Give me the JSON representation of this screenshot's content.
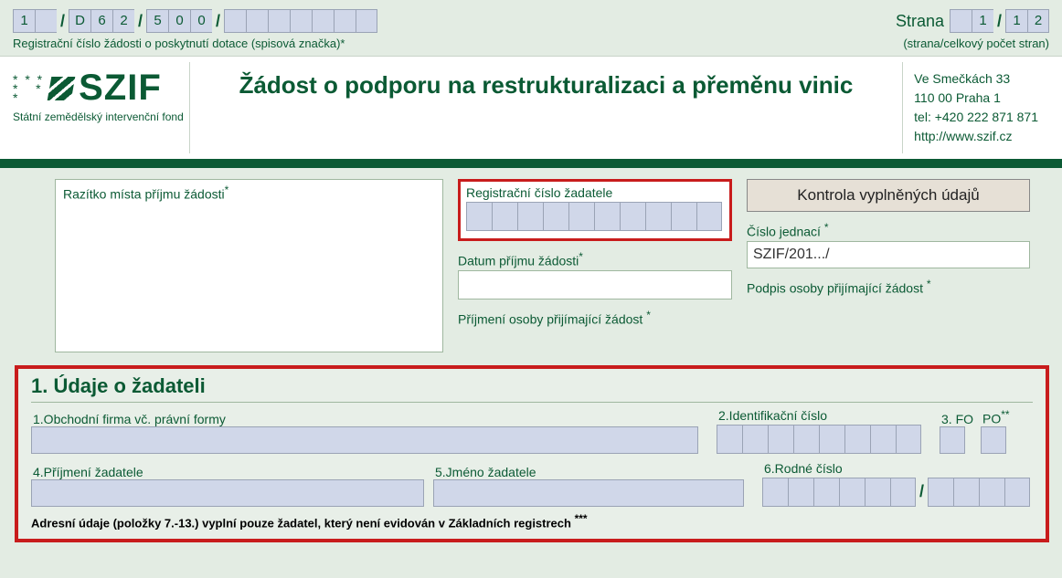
{
  "top": {
    "reg_cells1": [
      "1",
      ""
    ],
    "sep1": "/",
    "reg_cells2": [
      "D",
      "6",
      "2"
    ],
    "sep2": "/",
    "reg_cells3": [
      "5",
      "0",
      "0"
    ],
    "sep3": "/",
    "reg_cells4": [
      "",
      "",
      "",
      "",
      "",
      "",
      ""
    ],
    "reg_label": "Registrační číslo žádosti o poskytnutí dotace (spisová značka)*",
    "page_label": "Strana",
    "page_cells1": [
      "",
      "1"
    ],
    "page_sep": "/",
    "page_cells2": [
      "1",
      "2"
    ],
    "page_sub": "(strana/celkový počet stran)"
  },
  "header": {
    "logo_word": "SZIF",
    "logo_sub": "Státní zemědělský intervenční fond",
    "title": "Žádost o podporu na restrukturalizaci a přeměnu vinic",
    "address": "Ve Smečkách 33\n110 00 Praha 1\ntel: +420 222 871 871\nhttp://www.szif.cz"
  },
  "form": {
    "stamp_label": "Razítko místa příjmu žádosti",
    "stamp_star": "*",
    "reg_applicant_label": "Registrační číslo žadatele",
    "date_label": "Datum příjmu žádosti",
    "date_star": "*",
    "surname_label": "Příjmení osoby přijímající žádost",
    "surname_star": "*",
    "btn_check": "Kontrola vyplněných údajů",
    "refno_label": "Číslo jednací",
    "refno_star": "*",
    "refno_value": "SZIF/201.../",
    "sign_label": "Podpis osoby přijímající žádost",
    "sign_star": "*"
  },
  "section": {
    "title": "1. Údaje o žadateli",
    "f1": "1.Obchodní firma vč. právní formy",
    "f2": "2.Identifikační číslo",
    "f3": "3. FO",
    "f3b": "PO",
    "f3bstar": "**",
    "f4": "4.Příjmení žadatele",
    "f5": "5.Jméno žadatele",
    "f6": "6.Rodné číslo",
    "f6sep": "/",
    "note": "Adresní údaje (položky 7.-13.) vyplní pouze žadatel, který není evidován v Základních registrech",
    "note_star": "***"
  }
}
